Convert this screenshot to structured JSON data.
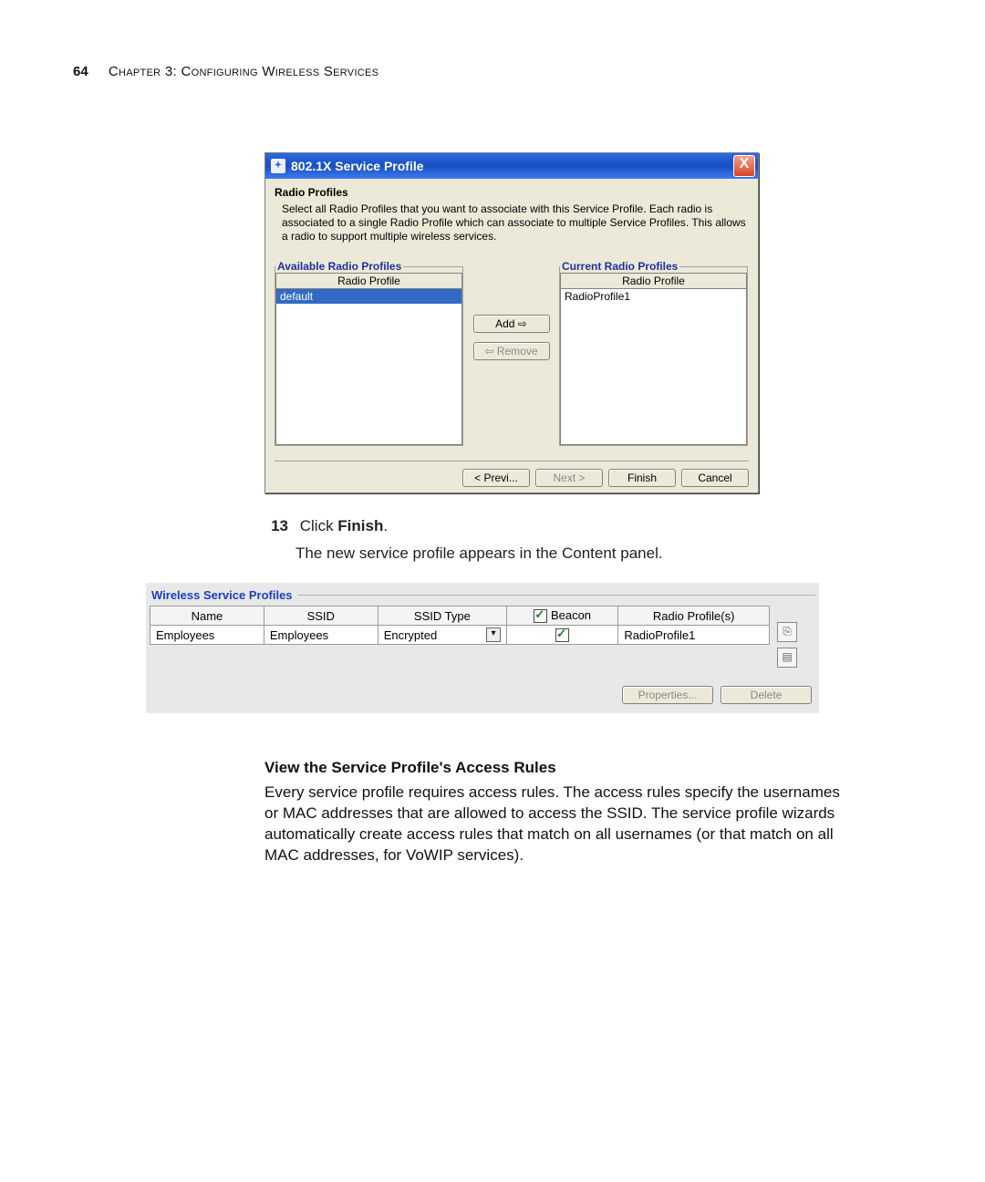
{
  "page": {
    "number": "64",
    "chapter_label": "Chapter 3: Configuring Wireless Services"
  },
  "dialog": {
    "title": "802.1X Service Profile",
    "close_glyph": "X",
    "section_title": "Radio Profiles",
    "description": "Select all Radio Profiles that you want to associate with this Service Profile. Each radio is associated to a single Radio Profile which can associate to multiple Service Profiles. This allows a radio to support multiple wireless services.",
    "available": {
      "legend": "Available Radio Profiles",
      "header": "Radio Profile",
      "items": [
        "default"
      ]
    },
    "current": {
      "legend": "Current Radio Profiles",
      "header": "Radio Profile",
      "items": [
        "RadioProfile1"
      ]
    },
    "buttons": {
      "add": "Add ⇨",
      "remove": "⇦ Remove",
      "prev": "< Previ...",
      "next": "Next >",
      "finish": "Finish",
      "cancel": "Cancel"
    }
  },
  "step": {
    "number": "13",
    "text_prefix": "Click ",
    "text_bold": "Finish",
    "text_suffix": ".",
    "followup": "The new service profile appears in the Content panel."
  },
  "wsp": {
    "legend": "Wireless Service Profiles",
    "headers": {
      "name": "Name",
      "ssid": "SSID",
      "ssid_type": "SSID Type",
      "beacon": "Beacon",
      "radio": "Radio Profile(s)"
    },
    "row": {
      "name": "Employees",
      "ssid": "Employees",
      "ssid_type": "Encrypted",
      "beacon_checked": true,
      "radio": "RadioProfile1"
    },
    "buttons": {
      "properties": "Properties...",
      "delete": "Delete"
    }
  },
  "section": {
    "title": "View the Service Profile's Access Rules",
    "paragraph": "Every service profile requires access rules. The access rules specify the usernames or MAC addresses that are allowed to access the SSID. The service profile wizards automatically create access rules that match on all usernames (or that match on all MAC addresses, for VoWIP services)."
  }
}
